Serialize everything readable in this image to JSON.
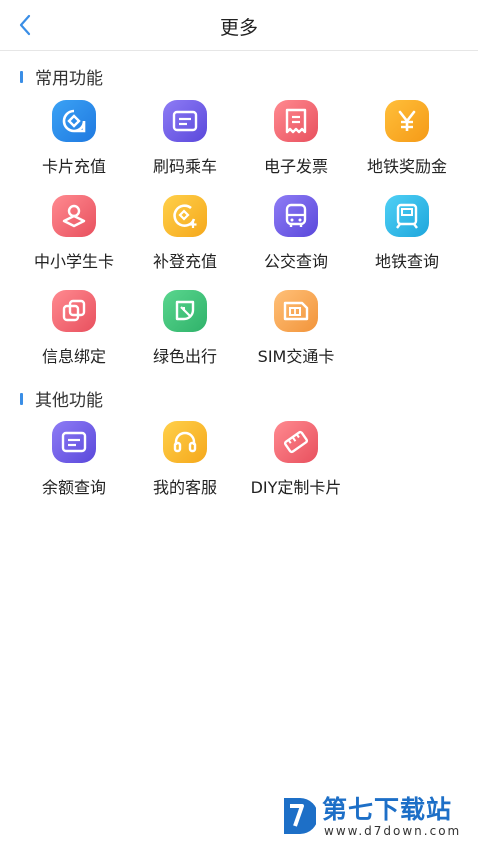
{
  "header": {
    "title": "更多",
    "back_icon": "chevron-left-icon"
  },
  "sections": [
    {
      "title": "常用功能",
      "items": [
        {
          "label": "卡片充值",
          "icon": "card-recharge-icon",
          "color": "#2f8fe8"
        },
        {
          "label": "刷码乘车",
          "icon": "qr-ride-icon",
          "color": "#6c5ce7"
        },
        {
          "label": "电子发票",
          "icon": "invoice-icon",
          "color": "#f0606f"
        },
        {
          "label": "地铁奖励金",
          "icon": "yuan-reward-icon",
          "color": "#f5a623"
        },
        {
          "label": "中小学生卡",
          "icon": "student-card-icon",
          "color": "#f26a76"
        },
        {
          "label": "补登充值",
          "icon": "supplement-recharge-icon",
          "color": "#f5b922"
        },
        {
          "label": "公交查询",
          "icon": "bus-icon",
          "color": "#6a5fe0"
        },
        {
          "label": "地铁查询",
          "icon": "metro-icon",
          "color": "#27b5e8"
        },
        {
          "label": "信息绑定",
          "icon": "bind-info-icon",
          "color": "#f0606f"
        },
        {
          "label": "绿色出行",
          "icon": "leaf-icon",
          "color": "#3cc37a"
        },
        {
          "label": "SIM交通卡",
          "icon": "sim-card-icon",
          "color": "#f5a84f"
        }
      ]
    },
    {
      "title": "其他功能",
      "items": [
        {
          "label": "余额查询",
          "icon": "balance-icon",
          "color": "#6c5ce7"
        },
        {
          "label": "我的客服",
          "icon": "headset-icon",
          "color": "#f5b922"
        },
        {
          "label": "DIY定制卡片",
          "icon": "diy-card-icon",
          "color": "#f0606f"
        }
      ]
    }
  ],
  "watermark": {
    "name": "第七下载站",
    "url": "www.d7down.com"
  }
}
